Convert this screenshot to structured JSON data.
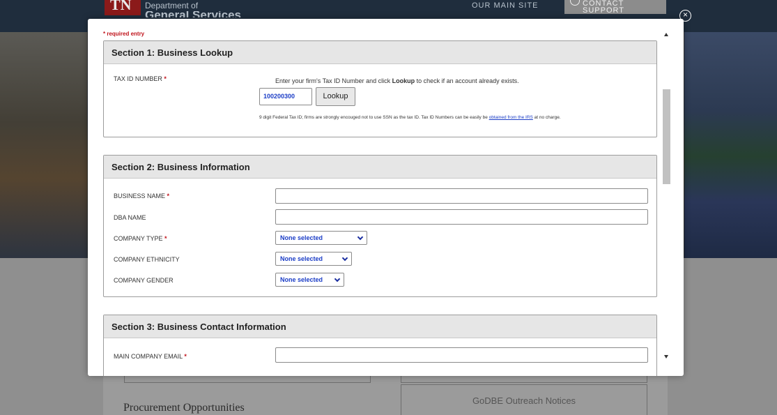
{
  "background": {
    "logo_text": "TN",
    "dept_line1": "Department of",
    "dept_line2": "General Services",
    "main_site_link": "OUR MAIN SITE",
    "contact_support": "CONTACT SUPPORT",
    "procurement_heading": "Procurement Opportunities",
    "godbe_label": "GoDBE Outreach Notices"
  },
  "modal": {
    "close_symbol": "×",
    "required_note": "* required entry",
    "section1": {
      "title": "Section 1: Business Lookup",
      "tax_id_label": "TAX ID NUMBER",
      "desc_prefix": "Enter your firm's Tax ID Number and click ",
      "desc_bold": "Lookup",
      "desc_suffix": " to check if an account already exists.",
      "tax_id_value": "100200300",
      "lookup_button": "Lookup",
      "help_text": "9 digit Federal Tax ID; firms are strongly encouged not to use SSN as the tax ID. Tax ID Numbers can be easily be ",
      "help_link": "obtained from the IRS",
      "help_suffix": " at no charge."
    },
    "section2": {
      "title": "Section 2: Business Information",
      "business_name_label": "BUSINESS NAME",
      "business_name_value": "",
      "dba_name_label": "DBA NAME",
      "dba_name_value": "",
      "company_type_label": "COMPANY TYPE",
      "company_type_value": "None selected",
      "company_ethnicity_label": "COMPANY ETHNICITY",
      "company_ethnicity_value": "None selected",
      "company_gender_label": "COMPANY GENDER",
      "company_gender_value": "None selected"
    },
    "section3": {
      "title": "Section 3: Business Contact Information",
      "main_email_label": "MAIN COMPANY EMAIL",
      "main_email_value": ""
    },
    "required_star": "*"
  },
  "colors": {
    "required": "#c0141c",
    "value_blue": "#1a3cc6",
    "section_header_bg": "#e6e6e6"
  }
}
